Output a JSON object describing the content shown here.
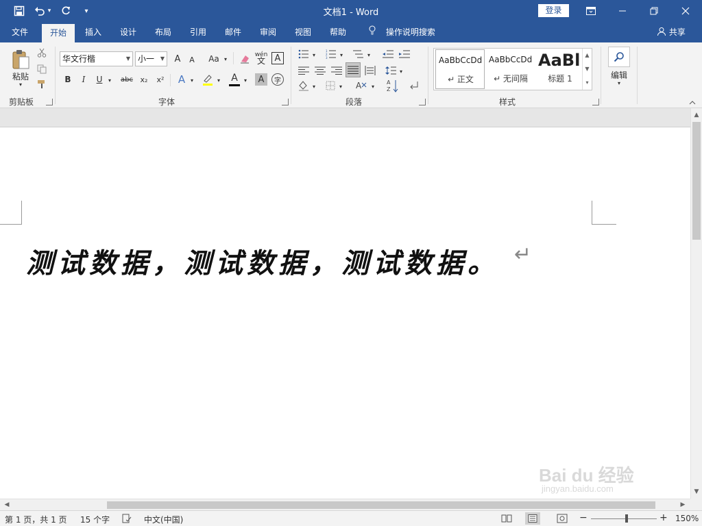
{
  "window": {
    "title": "文档1  -  Word",
    "login_label": "登录",
    "minimize_icon": "—",
    "restore_icon": "❐",
    "close_icon": "✕",
    "ribbon_display_icon": "▣"
  },
  "quick_access": {
    "save_icon": "💾",
    "undo_icon": "↶",
    "redo_icon": "↻",
    "customize_icon": "▾"
  },
  "tabs": [
    {
      "label": "文件"
    },
    {
      "label": "开始"
    },
    {
      "label": "插入"
    },
    {
      "label": "设计"
    },
    {
      "label": "布局"
    },
    {
      "label": "引用"
    },
    {
      "label": "邮件"
    },
    {
      "label": "审阅"
    },
    {
      "label": "视图"
    },
    {
      "label": "帮助"
    }
  ],
  "tell_me": "操作说明搜索",
  "share": "共享",
  "ribbon": {
    "clipboard": {
      "paste_label": "粘贴",
      "group_label": "剪贴板"
    },
    "font": {
      "font_name": "华文行楷",
      "font_size": "小一",
      "group_label": "字体",
      "bold": "B",
      "italic": "I",
      "underline": "U",
      "strike": "abc",
      "subscript": "x₂",
      "superscript": "x²",
      "grow": "A",
      "shrink": "A",
      "case": "Aa",
      "phonetic": "wén",
      "border_char": "A",
      "text_effect": "A",
      "font_color": "A",
      "char_shading": "A",
      "enclose": "字"
    },
    "paragraph": {
      "group_label": "段落"
    },
    "styles": {
      "group_label": "样式",
      "items": [
        {
          "sample": "AaBbCcDd",
          "name": "↵ 正文"
        },
        {
          "sample": "AaBbCcDd",
          "name": "↵ 无间隔"
        },
        {
          "sample": "AaBl",
          "name": "标题 1"
        }
      ]
    },
    "editing": {
      "label": "编辑"
    }
  },
  "document": {
    "text": "测试数据，测试数据，测试数据。",
    "para_mark": "↵"
  },
  "watermark": {
    "brand": "Bai du 经验",
    "url": "jingyan.baidu.com"
  },
  "status": {
    "page": "第 1 页，共 1 页",
    "words": "15 个字",
    "language": "中文(中国)",
    "zoom": "150%",
    "zoom_minus": "−",
    "zoom_plus": "+"
  },
  "colors": {
    "title_bar": "#2b579a",
    "ribbon_bg": "#f3f3f3",
    "font_color_bar": "#000000",
    "highlight_bar": "#ffff00"
  }
}
